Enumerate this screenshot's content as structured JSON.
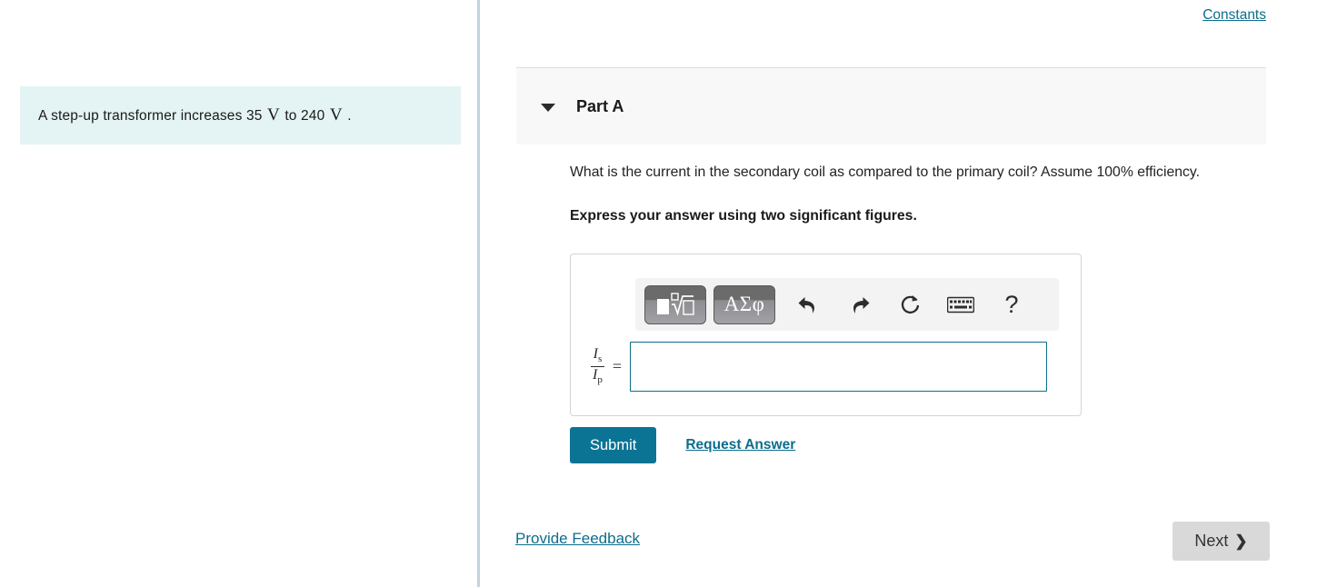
{
  "problem": {
    "text_before": "A step-up transformer increases 35",
    "unit_1": "V",
    "text_middle": "to 240",
    "unit_2": "V",
    "text_after": "."
  },
  "header": {
    "constants_link": "Constants"
  },
  "part": {
    "title": "Part A",
    "disclosure_state": "expanded",
    "question": "What is the current in the secondary coil as compared to the primary coil? Assume 100% efficiency.",
    "instruction": "Express your answer using two significant figures."
  },
  "answer": {
    "toolbar": {
      "template_button_label": "math-template",
      "greek_button_label": "ΑΣφ",
      "undo_label": "undo",
      "redo_label": "redo",
      "reset_label": "reset",
      "keyboard_label": "keyboard",
      "help_label": "?"
    },
    "expression": {
      "numerator_symbol": "I",
      "numerator_subscript": "s",
      "denominator_symbol": "I",
      "denominator_subscript": "p",
      "equals": "="
    },
    "input_value": "",
    "input_placeholder": ""
  },
  "actions": {
    "submit_label": "Submit",
    "request_answer_label": "Request Answer"
  },
  "footer": {
    "feedback_label": "Provide Feedback",
    "next_label": "Next",
    "next_chevron": "❯"
  },
  "colors": {
    "link": "#0d6d8c",
    "submit_bg": "#0b7495",
    "problem_bg": "#e4f3f3",
    "part_header_bg": "#f8f8f8",
    "input_border": "#0d6d8c",
    "next_bg": "#d9d9d9",
    "divider": "#c3d3e0"
  }
}
